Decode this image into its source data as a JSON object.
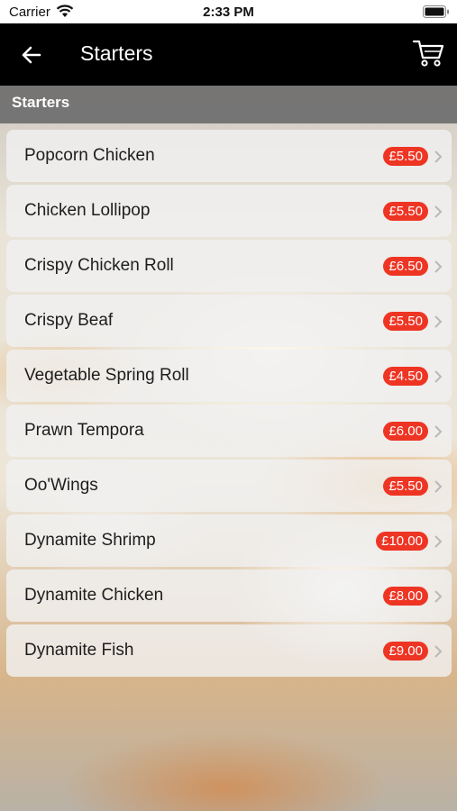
{
  "status_bar": {
    "carrier": "Carrier",
    "time": "2:33 PM"
  },
  "nav": {
    "title": "Starters",
    "back_icon": "arrow-left-icon",
    "cart_icon": "cart-icon"
  },
  "section": {
    "title": "Starters"
  },
  "colors": {
    "navbar": "#000000",
    "price_badge": "#ee3524",
    "section_bar": "#6e6e6e"
  },
  "items": [
    {
      "name": "Popcorn Chicken",
      "price": "£5.50"
    },
    {
      "name": "Chicken Lollipop",
      "price": "£5.50"
    },
    {
      "name": "Crispy Chicken Roll",
      "price": "£6.50"
    },
    {
      "name": "Crispy Beaf",
      "price": "£5.50"
    },
    {
      "name": "Vegetable Spring Roll",
      "price": "£4.50"
    },
    {
      "name": "Prawn Tempora",
      "price": "£6.00"
    },
    {
      "name": "Oo'Wings",
      "price": "£5.50"
    },
    {
      "name": "Dynamite Shrimp",
      "price": "£10.00"
    },
    {
      "name": "Dynamite Chicken",
      "price": "£8.00"
    },
    {
      "name": "Dynamite Fish",
      "price": "£9.00"
    }
  ]
}
